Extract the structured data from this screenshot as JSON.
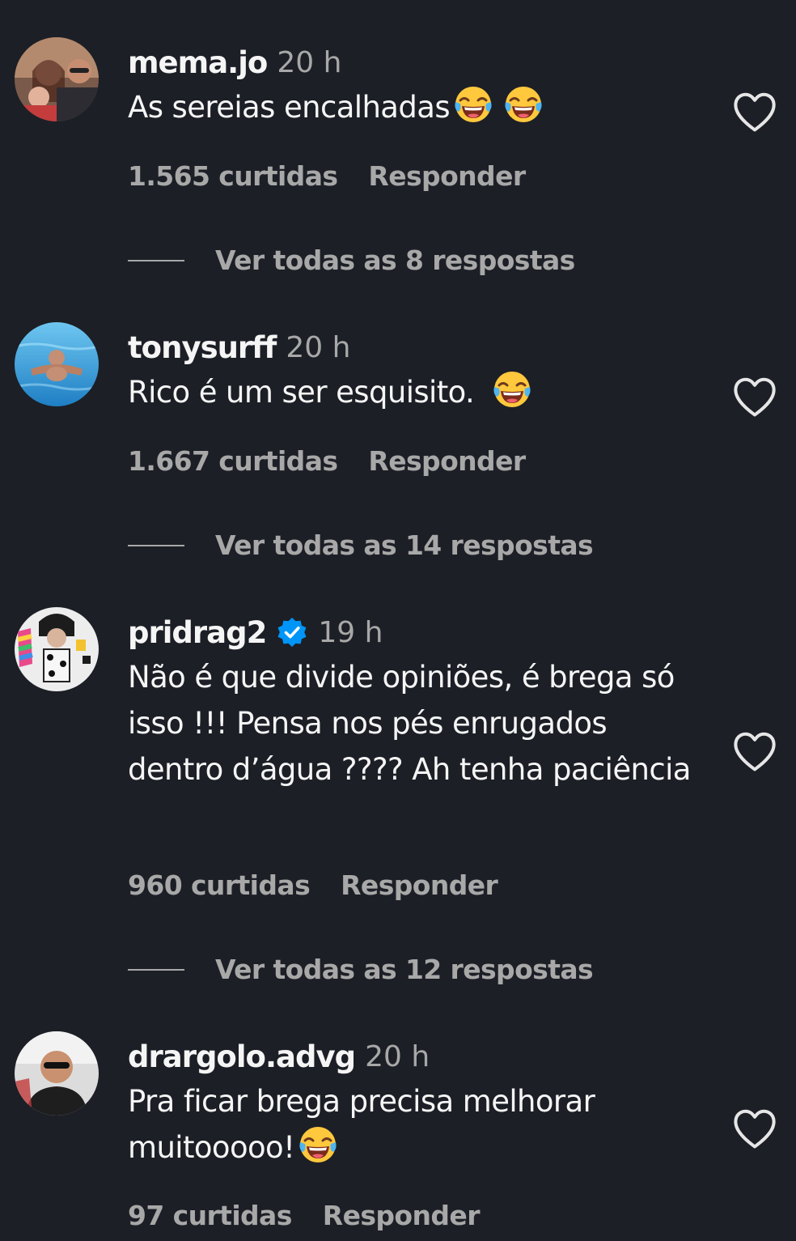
{
  "comments": [
    {
      "username": "mema.jo",
      "time": "20 h",
      "text": "As sereias encalhadas",
      "likes": "1.565 curtidas",
      "reply_label": "Responder",
      "view_replies": "Ver todas as 8 respostas"
    },
    {
      "username": "tonysurff",
      "time": "20 h",
      "text": "Rico é um ser esquisito.",
      "likes": "1.667 curtidas",
      "reply_label": "Responder",
      "view_replies": "Ver todas as 14 respostas"
    },
    {
      "username": "pridrag2",
      "time": "19 h",
      "verified": true,
      "text": "Não é que divide opiniões, é brega só isso !!! Pensa nos pés enrugados dentro d’água ???? Ah tenha paciência",
      "likes": "960 curtidas",
      "reply_label": "Responder",
      "view_replies": "Ver todas as 12 respostas"
    },
    {
      "username": "drargolo.advg",
      "time": "20 h",
      "text": "Pra ficar brega precisa melhorar muitooooo!",
      "likes": "97 curtidas",
      "reply_label": "Responder"
    }
  ],
  "colors": {
    "background": "#1c1f26",
    "primary_text": "#f5f5f5",
    "secondary_text": "#a8a8a8",
    "verified_badge": "#0095f6"
  },
  "icons": {
    "like": "heart-outline-icon",
    "verified": "verified-badge-icon",
    "emoji": "face-with-tears-of-joy-emoji"
  }
}
